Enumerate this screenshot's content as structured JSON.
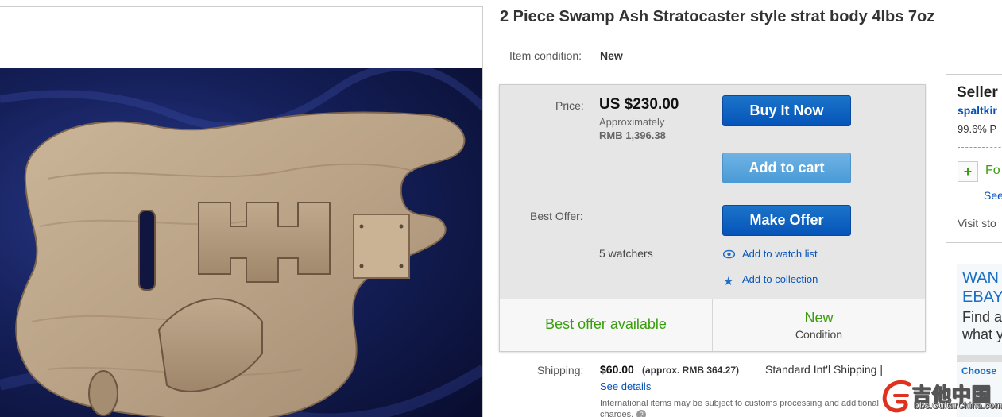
{
  "listing": {
    "title": "2 Piece Swamp Ash Stratocaster style strat body 4lbs 7oz",
    "condition_label": "Item condition:",
    "condition_value": "New"
  },
  "buybox": {
    "price_label": "Price:",
    "price": "US $230.00",
    "approx_label": "Approximately",
    "approx_value": "RMB 1,396.38",
    "buy_now": "Buy It Now",
    "add_to_cart": "Add to cart",
    "best_offer_label": "Best Offer:",
    "make_offer": "Make Offer",
    "watchers": "5 watchers",
    "add_watch": "Add to watch list",
    "add_collection": "Add to collection",
    "best_offer_available": "Best offer available",
    "condition_big": "New",
    "condition_small": "Condition"
  },
  "shipping": {
    "label": "Shipping:",
    "value": "$60.00",
    "approx": "(approx. RMB 364.27)",
    "method": "Standard Int'l Shipping |",
    "see_details": "See details",
    "note": "International items may be subject to customs processing and additional charges."
  },
  "seller": {
    "title": "Seller",
    "name": "spaltkir",
    "feedback": "99.6% P",
    "follow": "Fo",
    "see_other": "See",
    "visit_store": "Visit sto"
  },
  "ad": {
    "head_1": "WAN",
    "head_2": "EBAY",
    "body_1": "Find a",
    "body_2": "what y",
    "choose": "Choose"
  },
  "watermark": {
    "text": "吉他中国",
    "url": "bbs.GuitarChina.com"
  },
  "colors": {
    "link": "#0654ba",
    "button_dark": "#0654ba",
    "button_light": "#4a9ad6",
    "green": "#3a9e0c"
  }
}
